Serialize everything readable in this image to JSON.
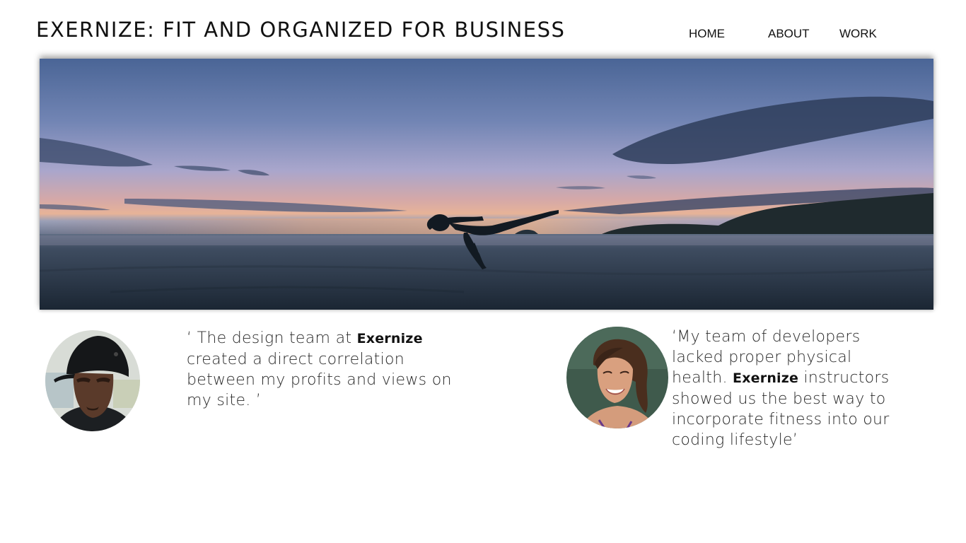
{
  "header": {
    "site_title": "EXERNIZE: FIT AND ORGANIZED FOR BUSINESS"
  },
  "nav": {
    "home": "HOME",
    "about": "ABOUT",
    "work": "WORK"
  },
  "hero": {
    "image": "silhouette of person doing yoga pose on beach at dusk"
  },
  "testimonials": [
    {
      "avatar": "man-with-backwards-cap-avatar",
      "quote_open": "‘ The design team at ",
      "brand": "Exernize",
      "quote_rest": " created a direct correlation between my profits and views on my site. ’"
    },
    {
      "avatar": "smiling-woman-avatar",
      "quote_open": "‘My team of developers lacked proper physical health. ",
      "brand": "Exernize",
      "quote_rest": " instructors showed us the best way to incorporate fitness into our coding lifestyle’"
    }
  ]
}
